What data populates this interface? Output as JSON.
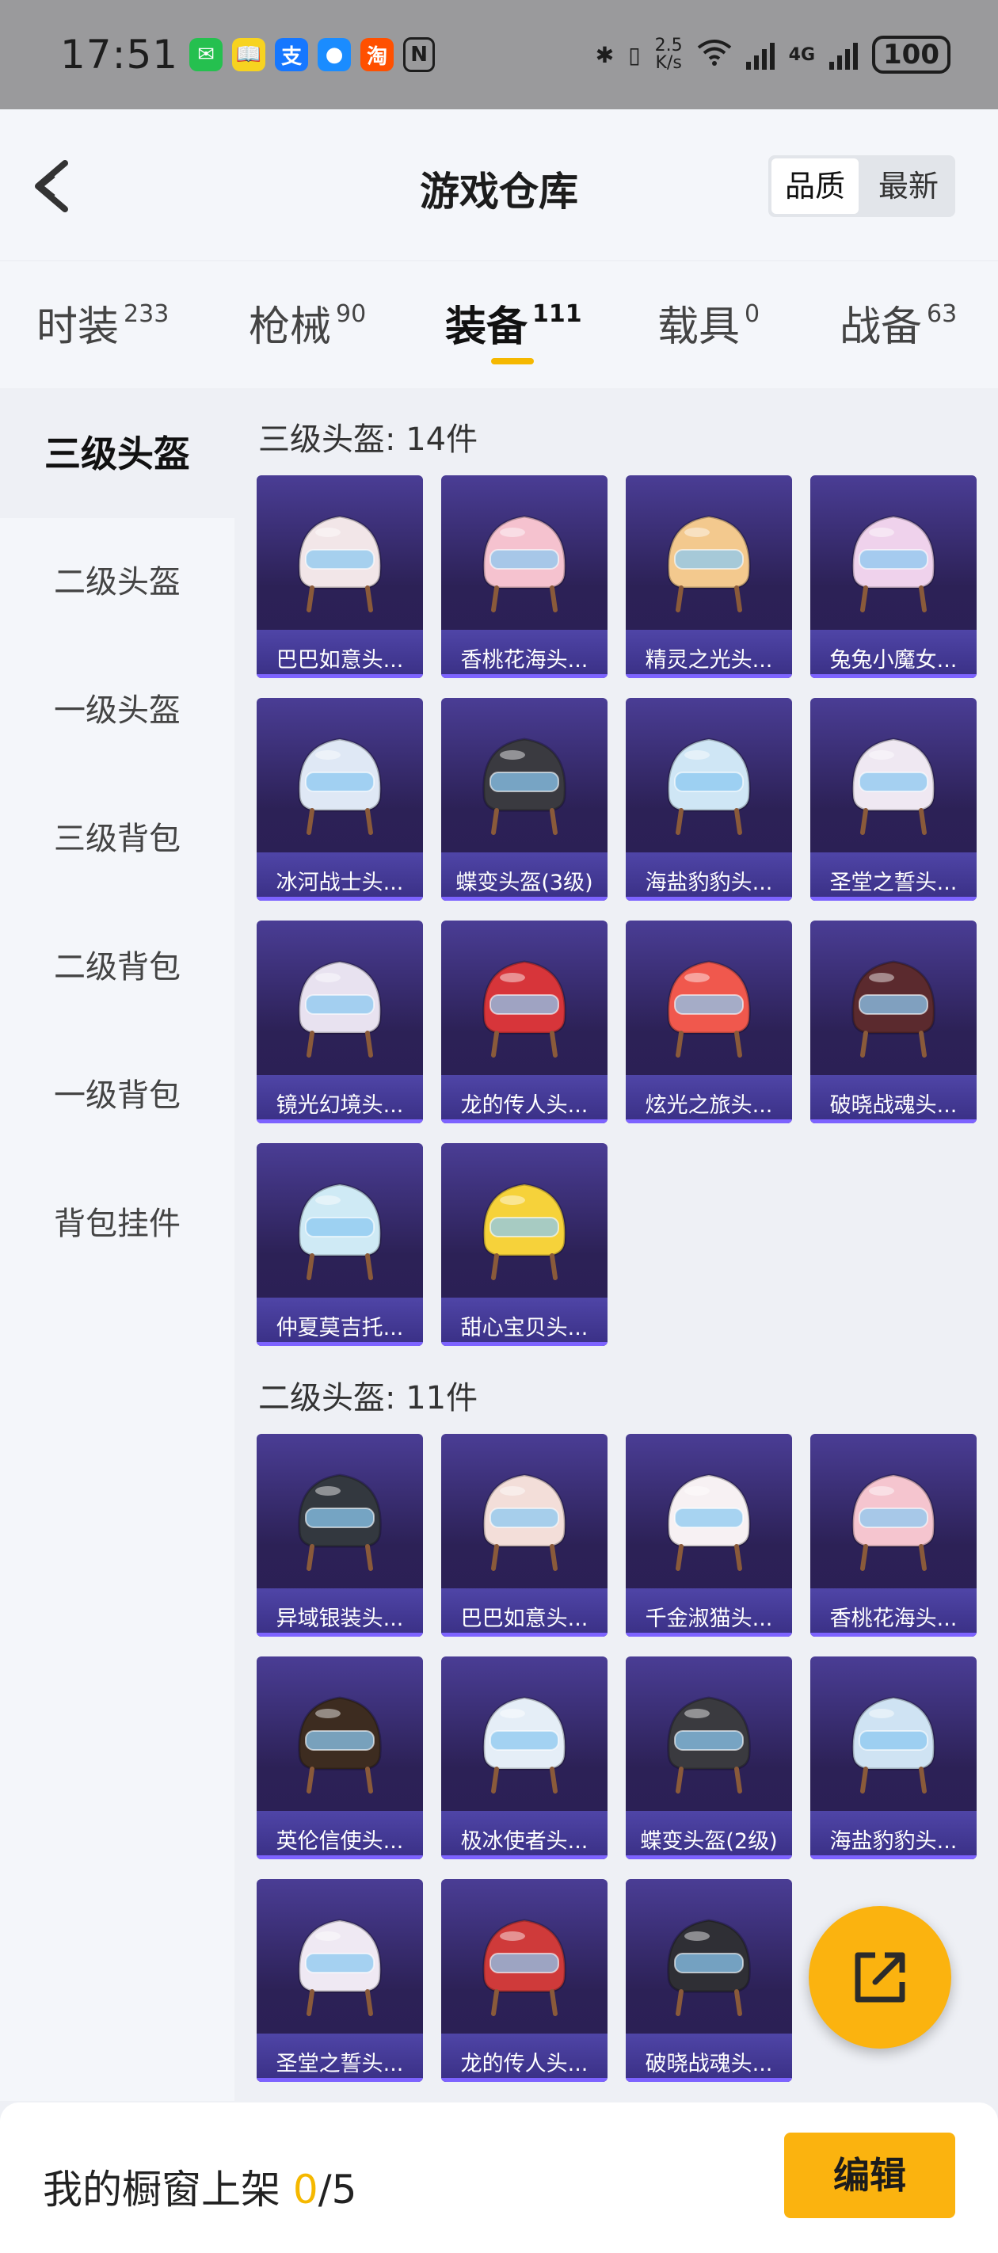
{
  "status_bar": {
    "time": "17:51",
    "apps": [
      {
        "icon": "wechat-icon",
        "glyph": "✉",
        "color": "#25c04f"
      },
      {
        "icon": "reading-app-icon",
        "glyph": "📖",
        "color": "#f7d320"
      },
      {
        "icon": "alipay-icon",
        "glyph": "支",
        "color": "#1677ff"
      },
      {
        "icon": "qq-icon",
        "glyph": "●",
        "color": "#1a8cff"
      },
      {
        "icon": "taobao-icon",
        "glyph": "淘",
        "color": "#ff5000"
      },
      {
        "icon": "nfc-icon",
        "glyph": "N",
        "color": "#9a9a9c"
      }
    ],
    "net_speed_value": "2.5",
    "net_speed_unit": "K/s",
    "network": "4G",
    "battery": "100"
  },
  "header": {
    "title": "游戏仓库",
    "sort_options": [
      "品质",
      "最新"
    ],
    "sort_selected": "品质"
  },
  "tabs": [
    {
      "label": "时装",
      "count": "233"
    },
    {
      "label": "枪械",
      "count": "90"
    },
    {
      "label": "装备",
      "count": "111"
    },
    {
      "label": "载具",
      "count": "0"
    },
    {
      "label": "战备",
      "count": "63"
    }
  ],
  "active_tab": "装备",
  "sidebar": [
    "三级头盔",
    "二级头盔",
    "一级头盔",
    "三级背包",
    "二级背包",
    "一级背包",
    "背包挂件"
  ],
  "active_sidebar": "三级头盔",
  "sections": [
    {
      "title": "三级头盔: 14件",
      "items": [
        {
          "name": "巴巴如意头...",
          "color": "#f2e6e8"
        },
        {
          "name": "香桃花海头...",
          "color": "#f5c2cf"
        },
        {
          "name": "精灵之光头...",
          "color": "#f3c98e"
        },
        {
          "name": "兔兔小魔女...",
          "color": "#efd2ec"
        },
        {
          "name": "冰河战士头...",
          "color": "#dfe8f5"
        },
        {
          "name": "蝶变头盔(3级)",
          "color": "#3a3a40"
        },
        {
          "name": "海盐豹豹头...",
          "color": "#cfe6f5"
        },
        {
          "name": "圣堂之誓头...",
          "color": "#efe8f2"
        },
        {
          "name": "镜光幻境头...",
          "color": "#e8e2f0"
        },
        {
          "name": "龙的传人头...",
          "color": "#d7353a"
        },
        {
          "name": "炫光之旅头...",
          "color": "#f0584d"
        },
        {
          "name": "破晓战魂头...",
          "color": "#5b2a2e"
        },
        {
          "name": "仲夏莫吉托...",
          "color": "#cfeaf5"
        },
        {
          "name": "甜心宝贝头...",
          "color": "#f6d23a"
        }
      ]
    },
    {
      "title": "二级头盔: 11件",
      "items": [
        {
          "name": "异域银装头...",
          "color": "#33383f"
        },
        {
          "name": "巴巴如意头...",
          "color": "#f3ded9"
        },
        {
          "name": "千金淑猫头...",
          "color": "#f7f1f3"
        },
        {
          "name": "香桃花海头...",
          "color": "#f5c5cf"
        },
        {
          "name": "英伦信使头...",
          "color": "#3d2c20"
        },
        {
          "name": "极冰使者头...",
          "color": "#e5eef7"
        },
        {
          "name": "蝶变头盔(2级)",
          "color": "#3a3a3f"
        },
        {
          "name": "海盐豹豹头...",
          "color": "#cfe3f3"
        },
        {
          "name": "圣堂之誓头...",
          "color": "#efe9f3"
        },
        {
          "name": "龙的传人头...",
          "color": "#cf3a3a"
        },
        {
          "name": "破晓战魂头...",
          "color": "#2f2f35"
        }
      ]
    }
  ],
  "bottom": {
    "label": "我的橱窗上架",
    "count": "0",
    "total": "/5",
    "edit_label": "编辑"
  }
}
